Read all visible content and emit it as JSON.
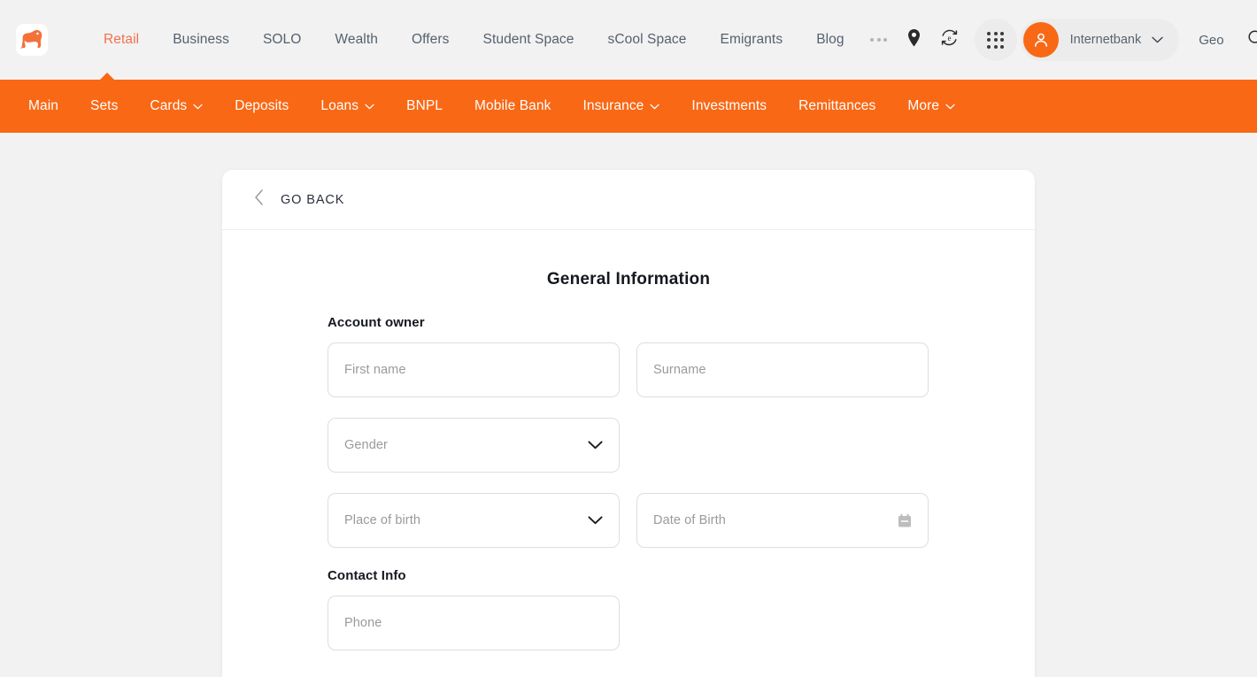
{
  "brand": {
    "accent": "#f96815",
    "accent_text": "#f2704b",
    "logo_icon": "bulldog-logo-icon"
  },
  "topbar": {
    "nav": [
      {
        "label": "Retail",
        "active": true
      },
      {
        "label": "Business",
        "active": false
      },
      {
        "label": "SOLO",
        "active": false
      },
      {
        "label": "Wealth",
        "active": false
      },
      {
        "label": "Offers",
        "active": false
      },
      {
        "label": "Student Space",
        "active": false
      },
      {
        "label": "sCool Space",
        "active": false
      },
      {
        "label": "Emigrants",
        "active": false
      },
      {
        "label": "Blog",
        "active": false
      }
    ],
    "more_icon": "ellipsis-icon",
    "location_icon": "location-pin-icon",
    "currency_icon": "currency-exchange-icon",
    "apps_icon": "apps-grid-icon",
    "account": {
      "avatar_icon": "user-avatar-icon",
      "label": "Internetbank",
      "chevron_icon": "chevron-down-icon"
    },
    "language": "Geo",
    "search_icon": "search-icon"
  },
  "mainnav": {
    "items": [
      {
        "label": "Main",
        "caret": false
      },
      {
        "label": "Sets",
        "caret": false
      },
      {
        "label": "Cards",
        "caret": true
      },
      {
        "label": "Deposits",
        "caret": false
      },
      {
        "label": "Loans",
        "caret": true
      },
      {
        "label": "BNPL",
        "caret": false
      },
      {
        "label": "Mobile Bank",
        "caret": false
      },
      {
        "label": "Insurance",
        "caret": true
      },
      {
        "label": "Investments",
        "caret": false
      },
      {
        "label": "Remittances",
        "caret": false
      },
      {
        "label": "More",
        "caret": true
      }
    ]
  },
  "card": {
    "back_icon": "chevron-left-icon",
    "back_label": "GO BACK",
    "title": "General Information",
    "sections": [
      {
        "label": "Account owner",
        "rows": [
          [
            {
              "name": "first-name-field",
              "placeholder": "First name",
              "kind": "text"
            },
            {
              "name": "surname-field",
              "placeholder": "Surname",
              "kind": "text"
            }
          ],
          [
            {
              "name": "gender-select",
              "placeholder": "Gender",
              "kind": "select"
            }
          ],
          [
            {
              "name": "place-of-birth-select",
              "placeholder": "Place of birth",
              "kind": "select"
            },
            {
              "name": "date-of-birth-field",
              "placeholder": "Date of Birth",
              "kind": "date"
            }
          ]
        ]
      },
      {
        "label": "Contact Info",
        "rows": [
          [
            {
              "name": "phone-field",
              "placeholder": "Phone",
              "kind": "text"
            }
          ]
        ]
      }
    ]
  }
}
